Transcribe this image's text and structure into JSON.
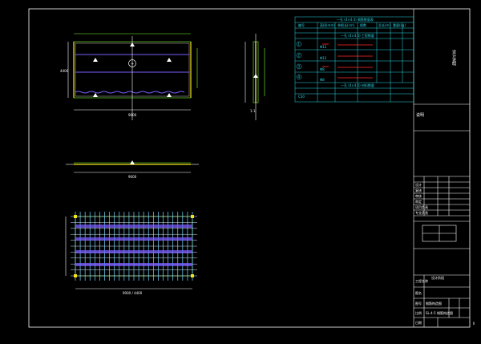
{
  "sheet": {
    "corner_mark": "",
    "revision_mark": "ⅠⅠ"
  },
  "plan_view": {
    "north_symbol": "+",
    "dim_bottom": "9000",
    "dim_left": "4400"
  },
  "section_view": {
    "dim_bottom": "9000"
  },
  "reinforcement_view": {
    "dim_bottom": "9000 / 4400"
  },
  "side_view": {
    "label": "1-1"
  },
  "material_table": {
    "title": "一孔 (4×4.4) 钢筋数量表",
    "headers": [
      "编号",
      "直径(mm)",
      "单根长(cm)",
      "根数",
      "总长(m)",
      "重量(kg)"
    ],
    "sub_title_1": "一孔 (4×4.4) 工程数量",
    "rows": [
      {
        "id": "1",
        "dia": "Φ12",
        "len": "",
        "count": "",
        "total": "",
        "weight": ""
      },
      {
        "id": "2",
        "dia": "Φ12",
        "len": "",
        "count": "",
        "total": "",
        "weight": ""
      },
      {
        "id": "3",
        "dia": "Φ8",
        "len": "",
        "count": "",
        "total": "",
        "weight": ""
      },
      {
        "id": "4",
        "dia": "Φ8",
        "len": "",
        "count": "",
        "total": "",
        "weight": ""
      }
    ],
    "sub_title_2": "一孔 (4×4.4) 材料数量",
    "footer_row": [
      "C30",
      "",
      "",
      "",
      "",
      ""
    ]
  },
  "notes_block": {
    "title": "说明",
    "vertical_text": "设计说明"
  },
  "title_block": {
    "company": "",
    "rows": [
      "设计",
      "复核",
      "审核",
      "审定",
      "项目负责",
      "专业负责",
      "校对"
    ],
    "drawing_name": "钢筋构造图",
    "sheet_title": "设计阶段",
    "labels": [
      "工程名称",
      "图名",
      "图号",
      "比例",
      "日期"
    ],
    "drawing_number": "SL-4-5 钢筋构造图"
  }
}
